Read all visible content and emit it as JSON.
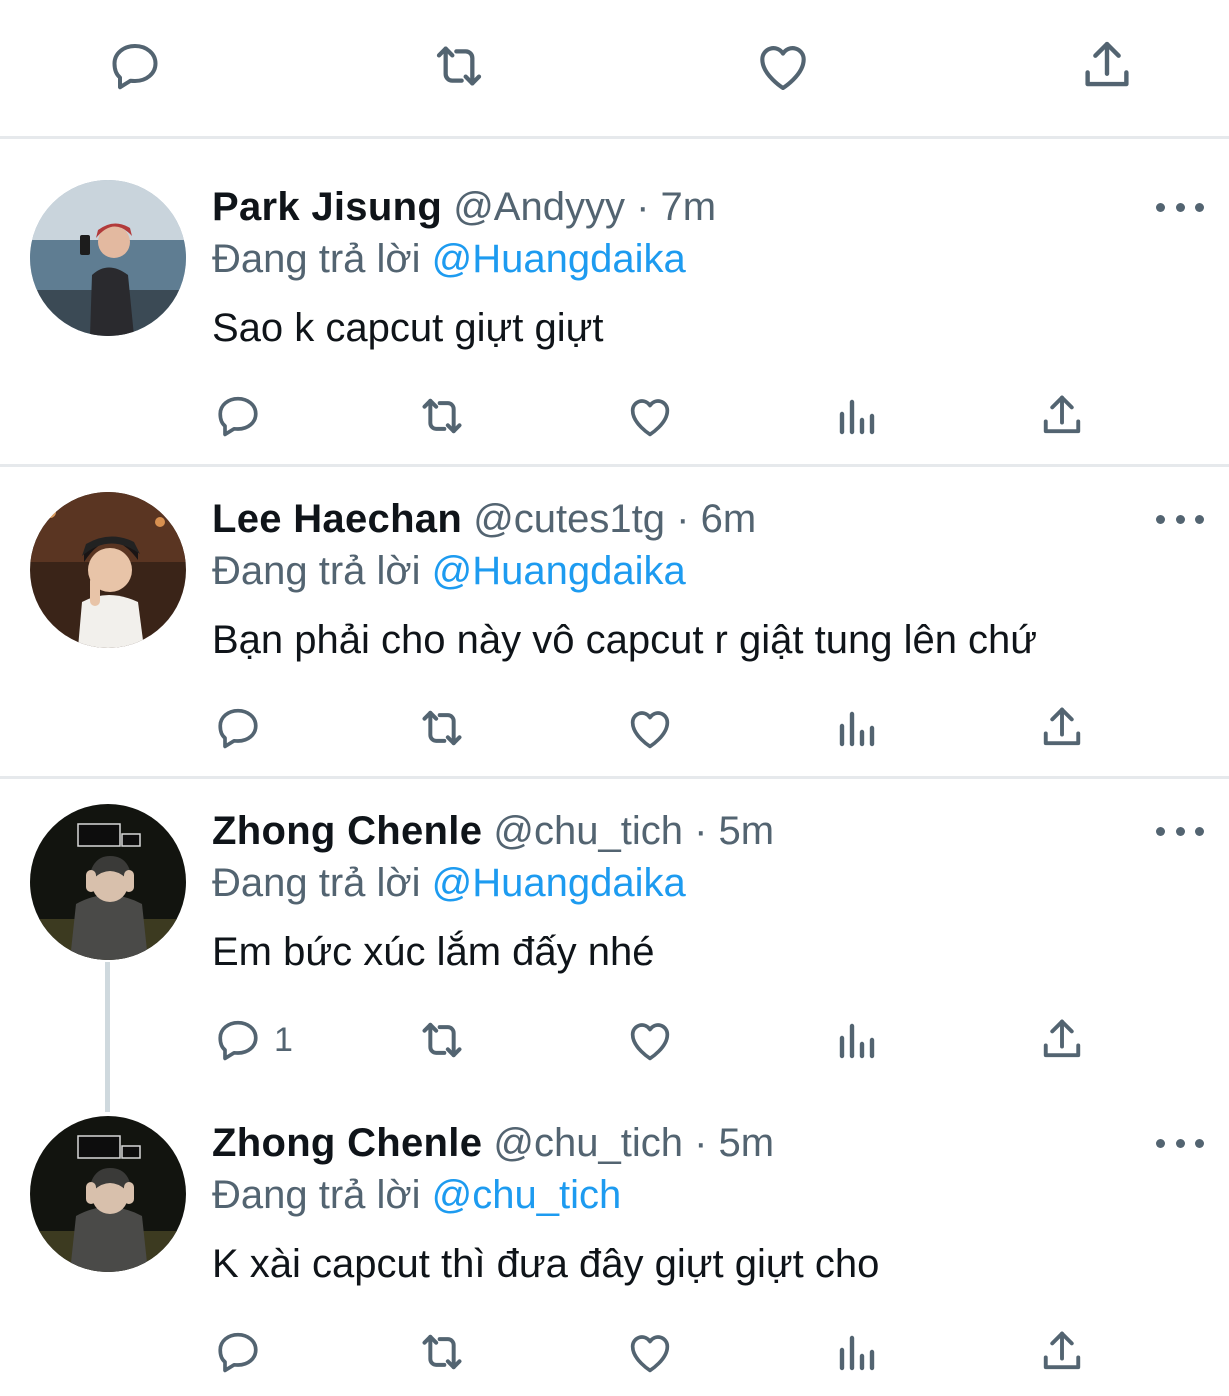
{
  "top_actions": {
    "reply": "reply-icon",
    "retweet": "retweet-icon",
    "like": "heart-icon",
    "share": "share-icon"
  },
  "tweets": [
    {
      "name": "Park Jisung",
      "handle": "@Andyyy",
      "separator": "·",
      "time": "7m",
      "replying_prefix": "Đang trả lời",
      "replying_to": "@Huangdaika",
      "text": "Sao k capcut giựt giựt",
      "reply_count": ""
    },
    {
      "name": "Lee Haechan",
      "handle": "@cutes1tg",
      "separator": "·",
      "time": "6m",
      "replying_prefix": "Đang trả lời",
      "replying_to": "@Huangdaika",
      "text": "Bạn phải cho này vô capcut r giật tung lên chứ",
      "reply_count": ""
    },
    {
      "name": "Zhong Chenle",
      "handle": "@chu_tich",
      "separator": "·",
      "time": "5m",
      "replying_prefix": "Đang trả lời",
      "replying_to": "@Huangdaika",
      "text": "Em bức xúc lắm đấy nhé",
      "reply_count": "1"
    },
    {
      "name": "Zhong Chenle",
      "handle": "@chu_tich",
      "separator": "·",
      "time": "5m",
      "replying_prefix": "Đang trả lời",
      "replying_to": "@chu_tich",
      "text": "K xài capcut thì đưa đây giựt giựt cho",
      "reply_count": ""
    }
  ],
  "colors": {
    "accent": "#1d9bf0",
    "secondary_text": "#536471",
    "icon": "#536471",
    "divider": "#e6e9ec"
  }
}
